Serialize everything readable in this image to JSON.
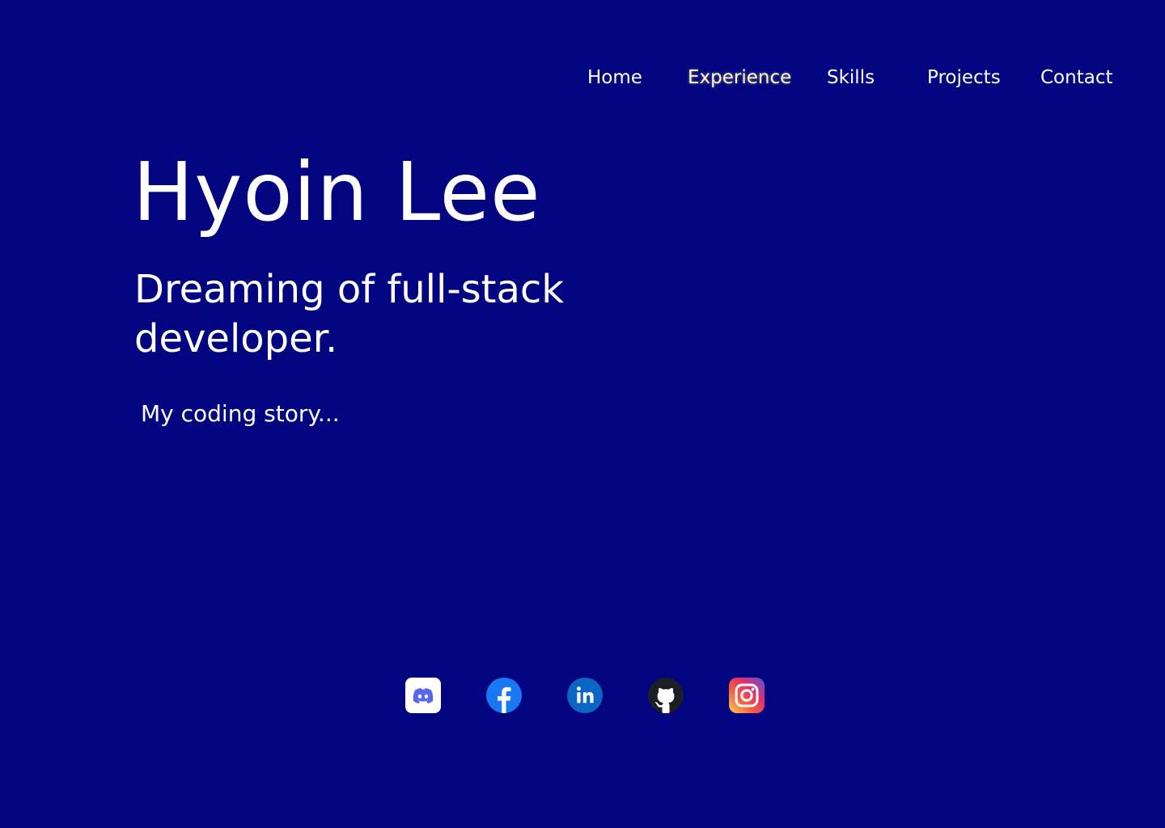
{
  "nav": {
    "items": [
      {
        "label": "Home"
      },
      {
        "label": "Experience",
        "active": true
      },
      {
        "label": "Skills"
      },
      {
        "label": "Projects"
      },
      {
        "label": "Contact"
      }
    ]
  },
  "hero": {
    "name": "Hyoin Lee",
    "tagline": "Dreaming of full-stack developer.",
    "story_link": "My coding story..."
  },
  "social": {
    "icons": [
      "discord-icon",
      "facebook-icon",
      "linkedin-icon",
      "github-icon",
      "instagram-icon"
    ]
  },
  "colors": {
    "background": "#02057f",
    "text": "#ffffff",
    "nav_active": "#fdf7c6",
    "discord": "#5865f2",
    "facebook": "#1877f2",
    "linkedin": "#0a66c2",
    "github": "#1b1f23"
  }
}
